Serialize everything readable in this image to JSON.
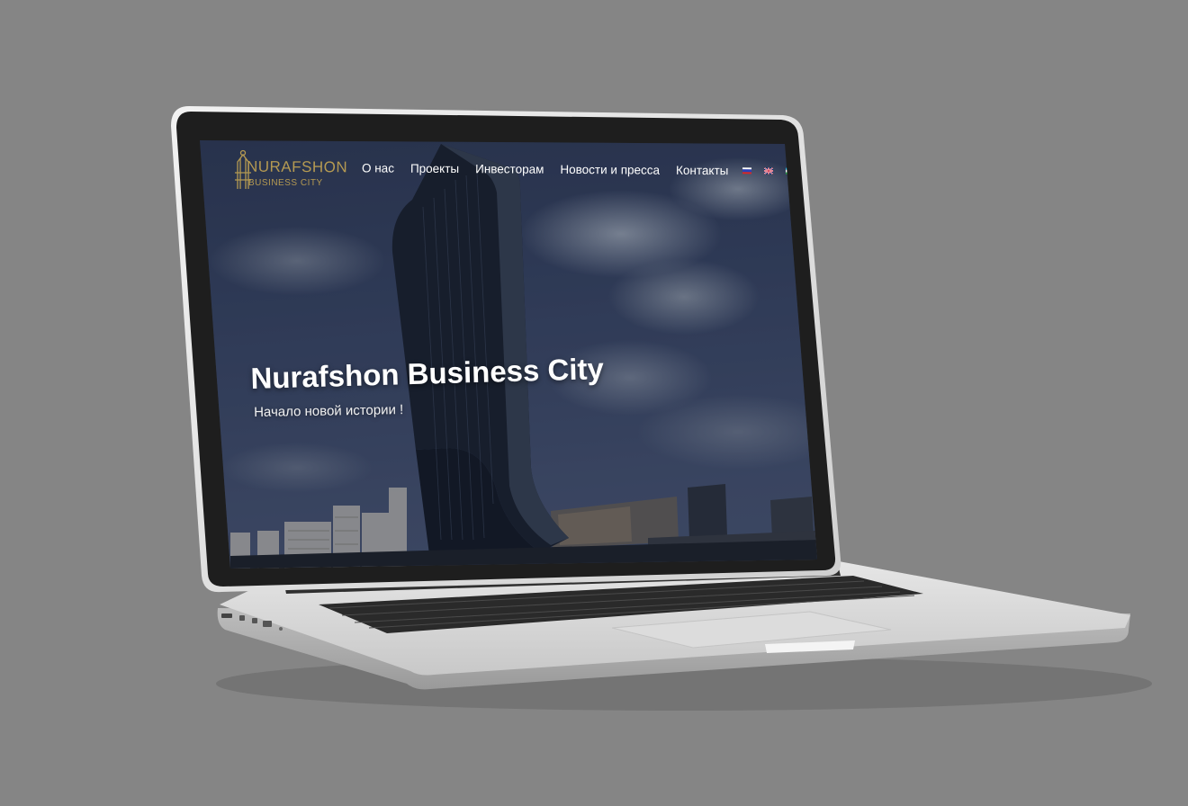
{
  "site": {
    "logo_line1": "NURAFSHON",
    "logo_line2": "BUSINESS CITY"
  },
  "nav": {
    "items": [
      {
        "label": "О нас"
      },
      {
        "label": "Проекты"
      },
      {
        "label": "Инвесторам"
      },
      {
        "label": "Новости и пресса"
      },
      {
        "label": "Контакты"
      }
    ],
    "languages": [
      {
        "icon": "flag-ru-icon",
        "colors": [
          "#ffffff",
          "#2b3fb8",
          "#d62828"
        ]
      },
      {
        "icon": "flag-gb-icon",
        "colors": [
          "#c8102e",
          "#ffffff",
          "#012169"
        ]
      },
      {
        "icon": "flag-uz-icon",
        "colors": [
          "#1eb5e0",
          "#ffffff",
          "#28a745"
        ]
      }
    ]
  },
  "hero": {
    "title": "Nurafshon Business City",
    "subtitle": "Начало новой истории !"
  },
  "colors": {
    "background": "#858585",
    "logo_gold": "#b59a52",
    "laptop_silver": "#d8d8d8",
    "bezel": "#1e1e1e"
  }
}
